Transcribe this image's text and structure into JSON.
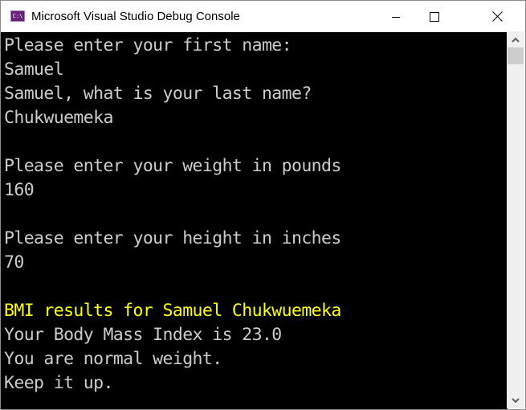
{
  "window": {
    "title": "Microsoft Visual Studio Debug Console",
    "icon": "console-app-icon",
    "icon_text": "C:\\",
    "controls": [
      "minimize-icon",
      "maximize-icon",
      "close-icon"
    ]
  },
  "console": {
    "default_color": "#cccccc",
    "highlight_color": "#ffff00",
    "lines": [
      {
        "text": "Please enter your first name:",
        "color": "#cccccc"
      },
      {
        "text": "Samuel",
        "color": "#cccccc"
      },
      {
        "text": "Samuel, what is your last name?",
        "color": "#cccccc"
      },
      {
        "text": "Chukwuemeka",
        "color": "#cccccc"
      },
      {
        "text": "",
        "color": "#cccccc"
      },
      {
        "text": "Please enter your weight in pounds",
        "color": "#cccccc"
      },
      {
        "text": "160",
        "color": "#cccccc"
      },
      {
        "text": "",
        "color": "#cccccc"
      },
      {
        "text": "Please enter your height in inches",
        "color": "#cccccc"
      },
      {
        "text": "70",
        "color": "#cccccc"
      },
      {
        "text": "",
        "color": "#cccccc"
      },
      {
        "text": "BMI results for Samuel Chukwuemeka",
        "color": "#ffff00"
      },
      {
        "text": "Your Body Mass Index is 23.0",
        "color": "#cccccc"
      },
      {
        "text": "You are normal weight.",
        "color": "#cccccc"
      },
      {
        "text": "Keep it up.",
        "color": "#cccccc"
      }
    ]
  },
  "scrollbar": {
    "up_icon": "chevron-up-icon",
    "down_icon": "chevron-down-icon"
  }
}
